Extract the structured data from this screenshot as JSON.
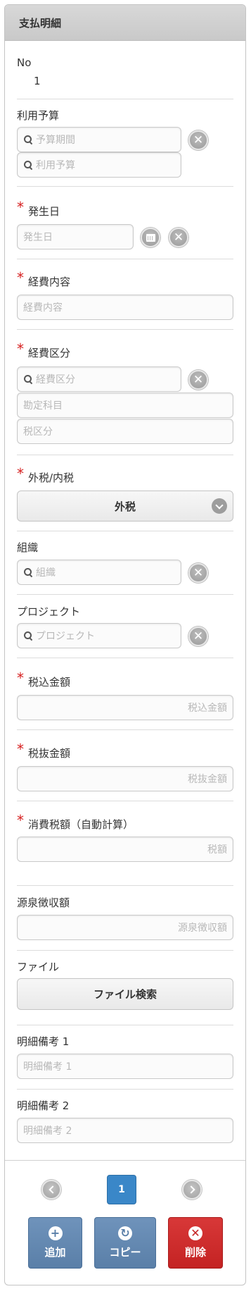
{
  "header": {
    "title": "支払明細"
  },
  "no": {
    "label": "No",
    "value": "1"
  },
  "budget": {
    "label": "利用予算",
    "period_placeholder": "予算期間",
    "budget_placeholder": "利用予算"
  },
  "date": {
    "label": "発生日",
    "placeholder": "発生日"
  },
  "content": {
    "label": "経費内容",
    "placeholder": "経費内容"
  },
  "category": {
    "label": "経費区分",
    "placeholder": "経費区分",
    "account_placeholder": "勘定科目",
    "tax_placeholder": "税区分"
  },
  "tax_type": {
    "label": "外税/内税",
    "value": "外税"
  },
  "org": {
    "label": "組織",
    "placeholder": "組織"
  },
  "project": {
    "label": "プロジェクト",
    "placeholder": "プロジェクト"
  },
  "incl": {
    "label": "税込金額",
    "placeholder": "税込金額"
  },
  "excl": {
    "label": "税抜金額",
    "placeholder": "税抜金額"
  },
  "ctax": {
    "label": "消費税額（自動計算）",
    "placeholder": "税額"
  },
  "withholding": {
    "label": "源泉徴収額",
    "placeholder": "源泉徴収額"
  },
  "file": {
    "label": "ファイル",
    "button": "ファイル検索"
  },
  "note1": {
    "label": "明細備考 1",
    "placeholder": "明細備考 1"
  },
  "note2": {
    "label": "明細備考 2",
    "placeholder": "明細備考 2"
  },
  "required_mark": "*",
  "pager": {
    "current": "1"
  },
  "actions": {
    "add": "追加",
    "copy": "コピー",
    "delete": "削除",
    "add_icon": "+",
    "copy_icon": "↻",
    "delete_icon": "✕"
  },
  "icons": {
    "clear": "✕"
  },
  "colors": {
    "accent": "#3a87c8",
    "action_blue": "#5a7fa8",
    "danger": "#c42323",
    "required": "#d62020"
  }
}
